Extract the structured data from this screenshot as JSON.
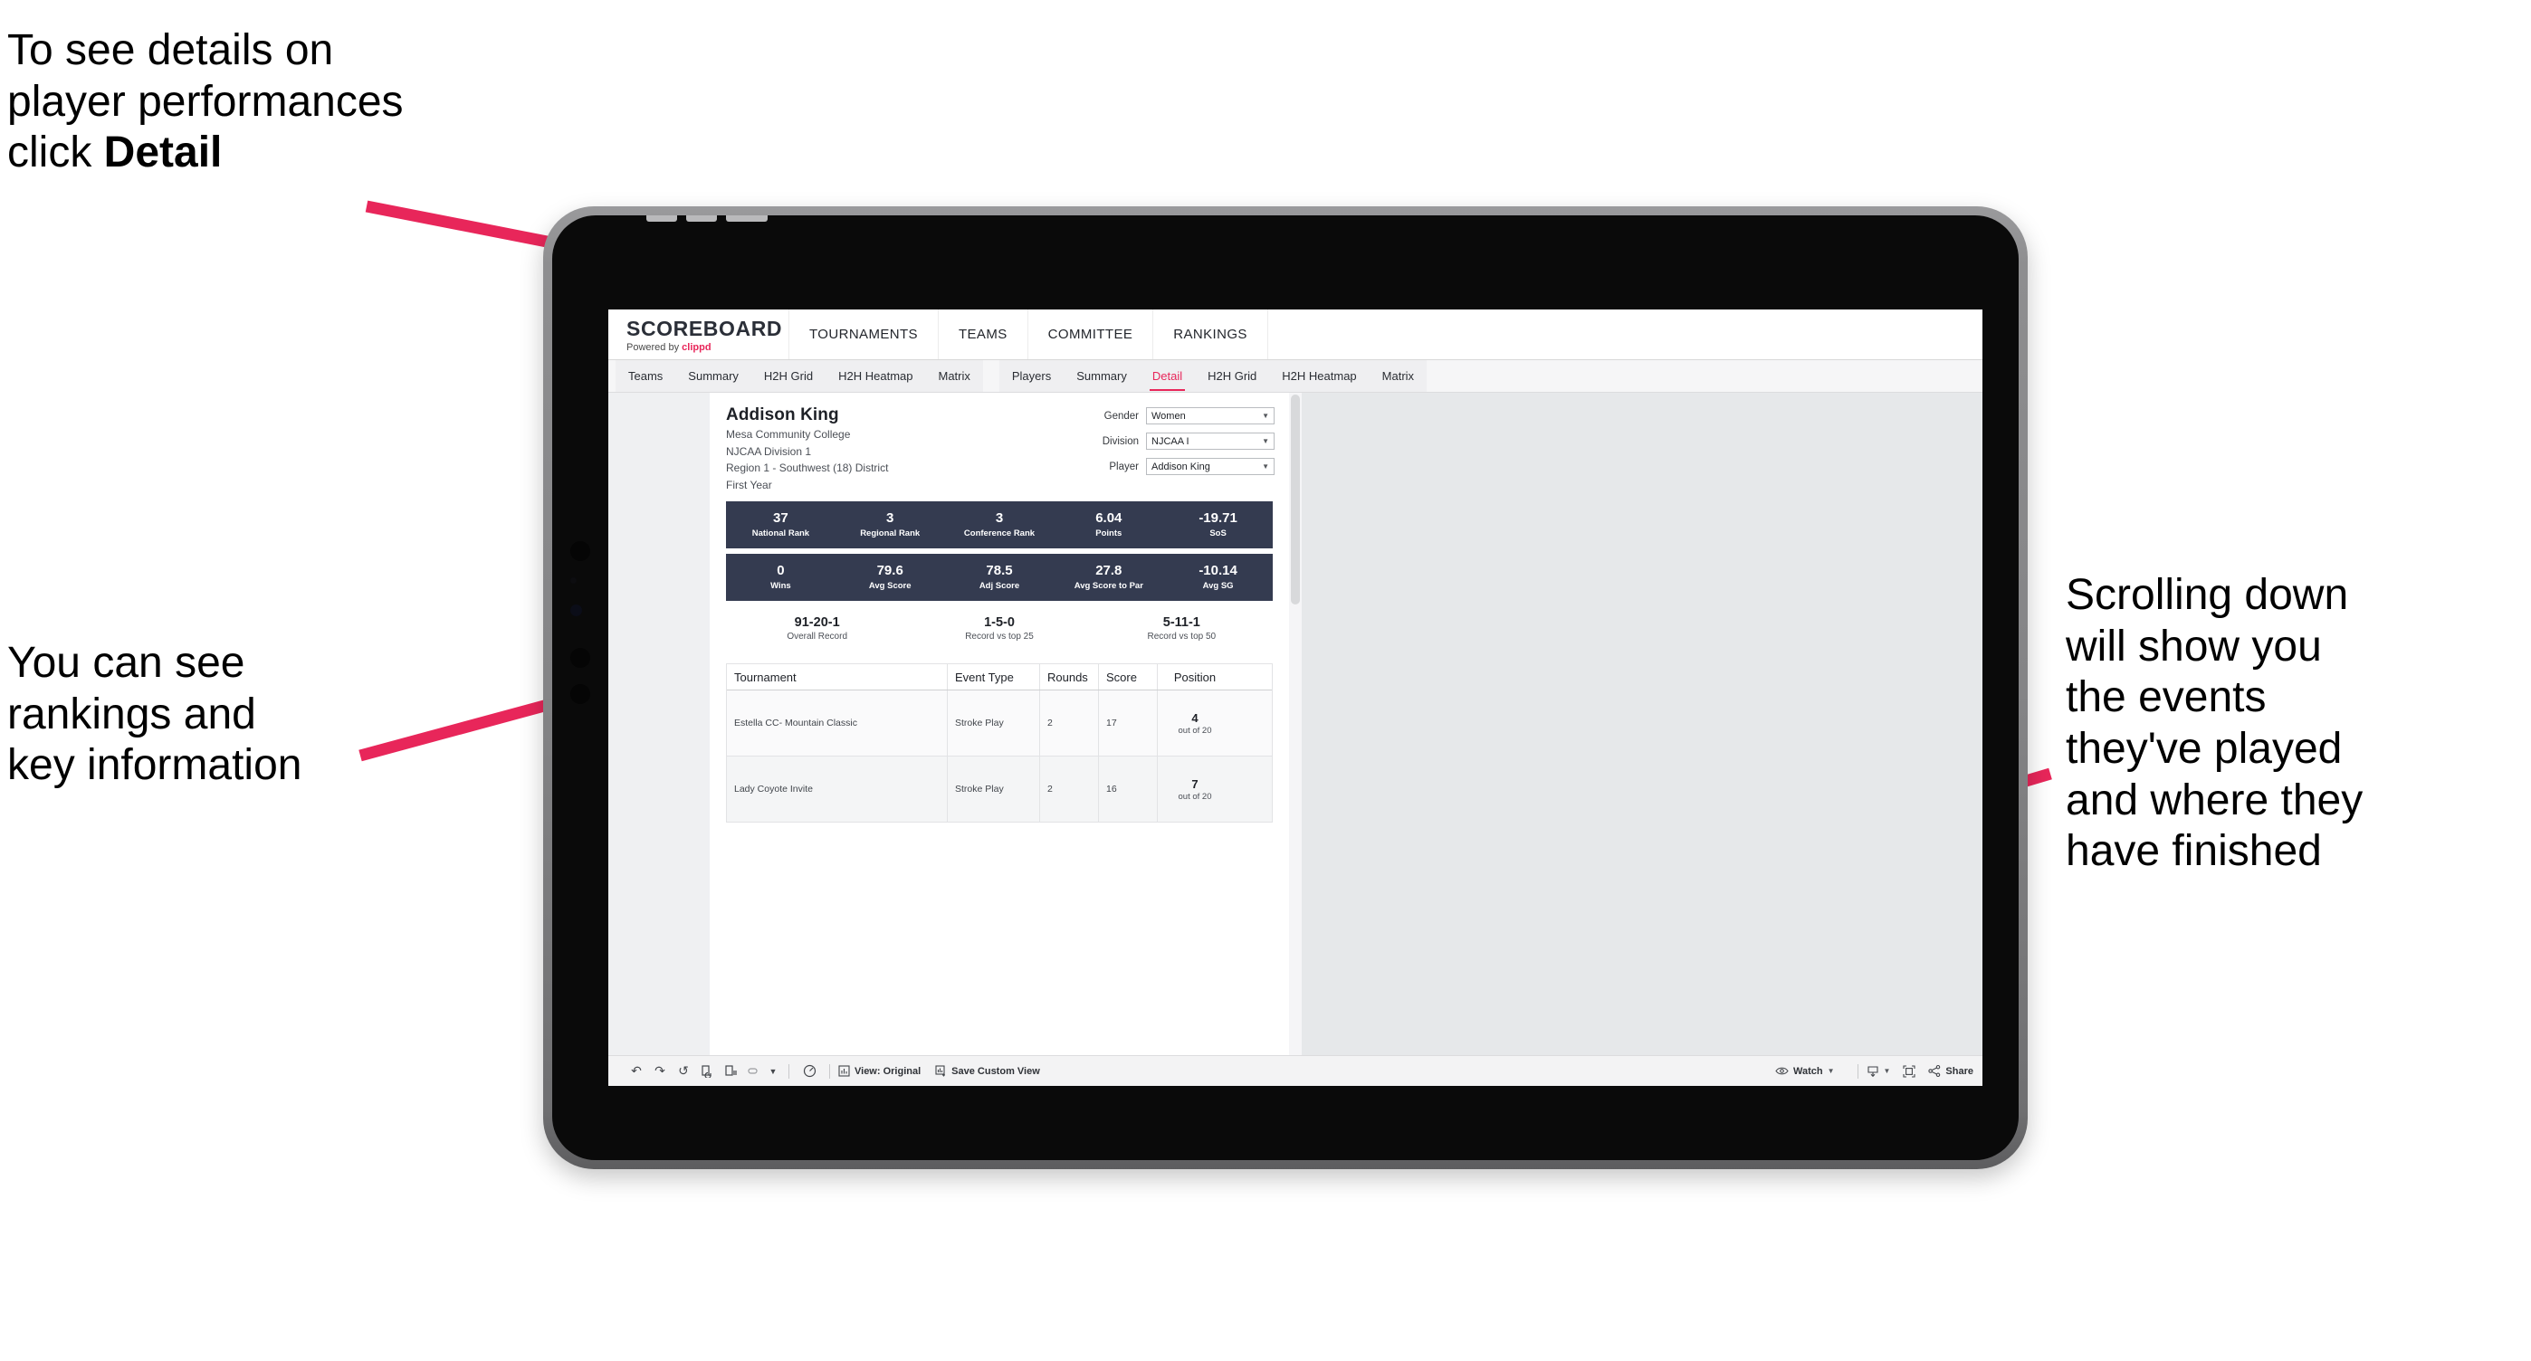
{
  "annotations": {
    "detail": "To see details on\nplayer performances\nclick ",
    "detail_bold": "Detail",
    "rankings": "You can see\nrankings and\nkey information",
    "scroll": "Scrolling down\nwill show you\nthe events\nthey've played\nand where they\nhave finished"
  },
  "app": {
    "brand": {
      "title": "SCOREBOARD",
      "powered_prefix": "Powered by ",
      "powered_brand": "clippd"
    },
    "top_nav": [
      "TOURNAMENTS",
      "TEAMS",
      "COMMITTEE",
      "RANKINGS"
    ],
    "tab_group_teams": [
      "Teams",
      "Summary",
      "H2H Grid",
      "H2H Heatmap",
      "Matrix"
    ],
    "tab_group_players": [
      "Players",
      "Summary",
      "Detail",
      "H2H Grid",
      "H2H Heatmap",
      "Matrix"
    ],
    "active_tab": "Detail"
  },
  "player": {
    "name": "Addison King",
    "school": "Mesa Community College",
    "division": "NJCAA Division 1",
    "region": "Region 1 - Southwest (18) District",
    "year": "First Year"
  },
  "filters": [
    {
      "label": "Gender",
      "value": "Women"
    },
    {
      "label": "Division",
      "value": "NJCAA I"
    },
    {
      "label": "Player",
      "value": "Addison King"
    }
  ],
  "stats_row_1": [
    {
      "value": "37",
      "label": "National Rank"
    },
    {
      "value": "3",
      "label": "Regional Rank"
    },
    {
      "value": "3",
      "label": "Conference Rank"
    },
    {
      "value": "6.04",
      "label": "Points"
    },
    {
      "value": "-19.71",
      "label": "SoS"
    }
  ],
  "stats_row_2": [
    {
      "value": "0",
      "label": "Wins"
    },
    {
      "value": "79.6",
      "label": "Avg Score"
    },
    {
      "value": "78.5",
      "label": "Adj Score"
    },
    {
      "value": "27.8",
      "label": "Avg Score to Par"
    },
    {
      "value": "-10.14",
      "label": "Avg SG"
    }
  ],
  "records": [
    {
      "value": "91-20-1",
      "label": "Overall Record"
    },
    {
      "value": "1-5-0",
      "label": "Record vs top 25"
    },
    {
      "value": "5-11-1",
      "label": "Record vs top 50"
    }
  ],
  "tournament_table": {
    "headers": [
      "Tournament",
      "Event Type",
      "Rounds",
      "Score",
      "Position"
    ],
    "rows": [
      {
        "tournament": "Estella CC- Mountain Classic",
        "event_type": "Stroke Play",
        "rounds": "2",
        "score": "17",
        "position_num": "4",
        "position_of": "out of 20"
      },
      {
        "tournament": "Lady Coyote Invite",
        "event_type": "Stroke Play",
        "rounds": "2",
        "score": "16",
        "position_num": "7",
        "position_of": "out of 20"
      }
    ]
  },
  "toolbar": {
    "view_original": "View: Original",
    "save_custom_view": "Save Custom View",
    "watch": "Watch",
    "share": "Share"
  },
  "colors": {
    "accent_pink": "#e8265a",
    "stat_navy": "#343b50",
    "screen_bg": "#e6e8ea"
  }
}
